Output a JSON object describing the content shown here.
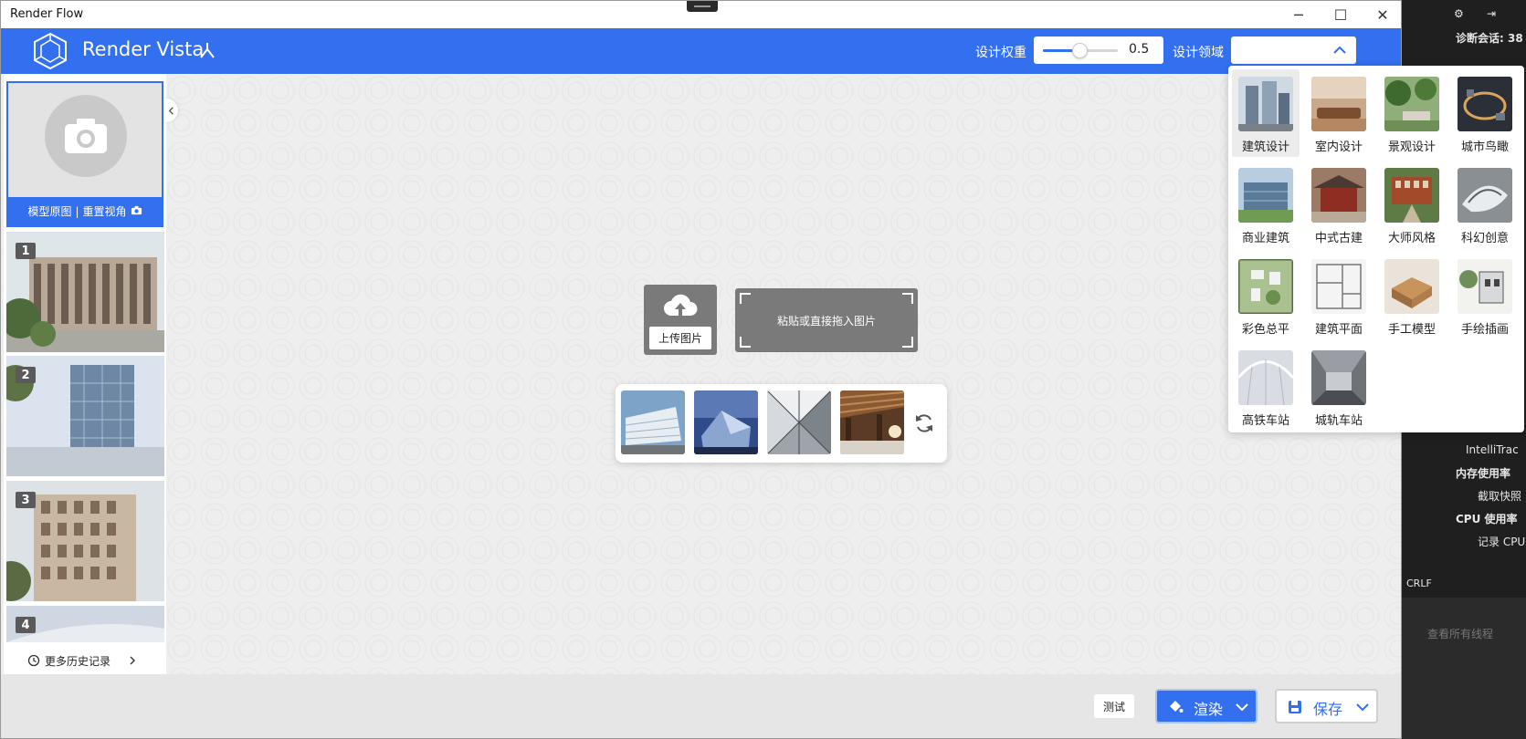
{
  "window": {
    "title": "Render Flow",
    "minimize": "─",
    "maximize": "☐",
    "close": "✕"
  },
  "header": {
    "app_name": "Render Vista",
    "weight_label": "设计权重",
    "weight_value": "0.5",
    "weight_fraction": 0.5,
    "domain_label": "设计领域",
    "domain_value": ""
  },
  "sidebar": {
    "original_label": "模型原图",
    "separator": "|",
    "reset_label": "重置视角",
    "history": [
      {
        "index": "1"
      },
      {
        "index": "2"
      },
      {
        "index": "3"
      },
      {
        "index": "4"
      }
    ],
    "more_history": "更多历史记录"
  },
  "upload": {
    "upload_label": "上传图片",
    "paste_label": "粘贴或直接拖入图片"
  },
  "footer": {
    "test_label": "测试",
    "render_label": "渲染",
    "save_label": "保存"
  },
  "dropdown": {
    "items": [
      {
        "label": "建筑设计"
      },
      {
        "label": "室内设计"
      },
      {
        "label": "景观设计"
      },
      {
        "label": "城市鸟瞰"
      },
      {
        "label": "商业建筑"
      },
      {
        "label": "中式古建"
      },
      {
        "label": "大师风格"
      },
      {
        "label": "科幻创意"
      },
      {
        "label": "彩色总平"
      },
      {
        "label": "建筑平面"
      },
      {
        "label": "手工模型"
      },
      {
        "label": "手绘插画"
      },
      {
        "label": "高铁车站"
      },
      {
        "label": "城轨车站"
      }
    ]
  },
  "ide": {
    "diag_session": "诊断会话: 38",
    "intellitrace": "IntelliTrac",
    "memory": "内存使用率",
    "snapshot": "截取快照",
    "cpu": "CPU 使用率",
    "record_cpu": "记录 CPU",
    "crlf": "CRLF",
    "threads": "查看所有线程"
  },
  "colors": {
    "accent": "#3370f0",
    "panel_gray": "#7a7a7a"
  }
}
